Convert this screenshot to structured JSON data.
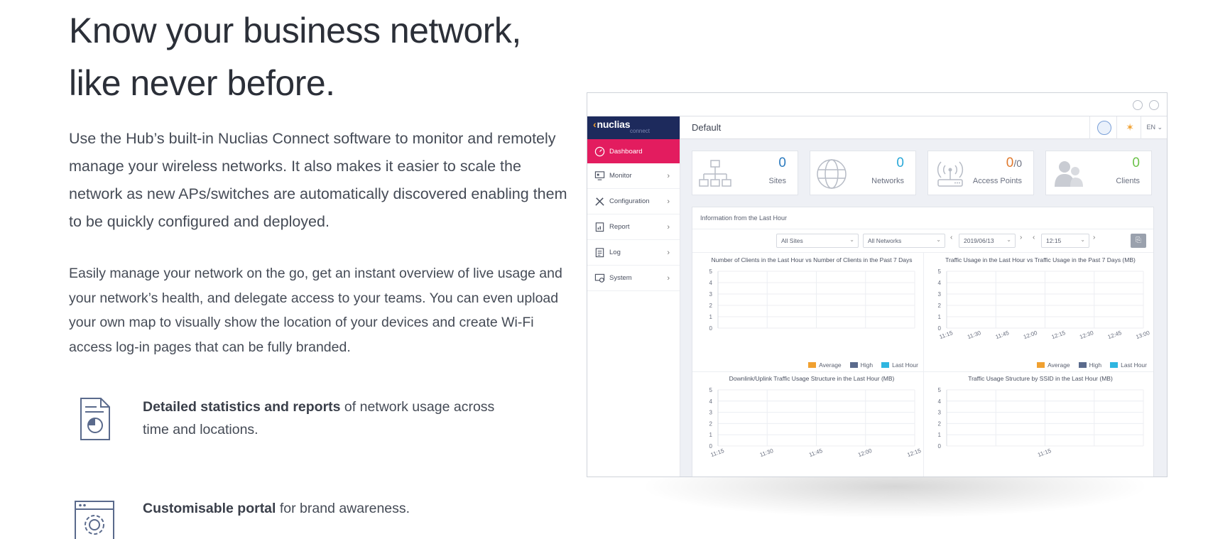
{
  "headline": {
    "line1": "Know your business network,",
    "line2": "like never before."
  },
  "intro": "Use the Hub’s built-in Nuclias Connect software to monitor and remotely manage your wireless networks. It also makes it easier to scale the network as new APs/switches are automatically discovered enabling them to be quickly configured and deployed.",
  "details": "Easily manage your network on the go, get an instant overview of live usage and your network’s health, and delegate access to your teams. You can even upload your own map to visually show the location of your devices and create Wi-Fi access log-in pages that can be fully branded.",
  "features": [
    {
      "icon": "report-document-icon",
      "bold": "Detailed statistics and reports",
      "rest": " of network usage across time and locations."
    },
    {
      "icon": "browser-gear-icon",
      "bold": "Customisable portal",
      "rest": " for brand awareness."
    }
  ],
  "app": {
    "brand": {
      "name": "nuclias",
      "sub": "connect"
    },
    "page_title": "Default",
    "language": "EN",
    "nav": [
      {
        "label": "Dashboard",
        "icon": "dashboard-gauge-icon",
        "active": true,
        "arrow": ""
      },
      {
        "label": "Monitor",
        "icon": "monitor-icon",
        "active": false,
        "arrow": "›"
      },
      {
        "label": "Configuration",
        "icon": "tools-icon",
        "active": false,
        "arrow": "›"
      },
      {
        "label": "Report",
        "icon": "report-icon",
        "active": false,
        "arrow": "›"
      },
      {
        "label": "Log",
        "icon": "log-icon",
        "active": false,
        "arrow": "›"
      },
      {
        "label": "System",
        "icon": "system-icon",
        "active": false,
        "arrow": "›"
      }
    ],
    "stats": [
      {
        "label": "Sites",
        "value": "0",
        "icon": "sites-tree-icon"
      },
      {
        "label": "Networks",
        "value": "0",
        "icon": "globe-icon"
      },
      {
        "label": "Access Points",
        "value": "0",
        "value_suffix": "/0",
        "icon": "access-point-icon"
      },
      {
        "label": "Clients",
        "value": "0",
        "icon": "clients-icon"
      }
    ],
    "panel": {
      "title": "Information from the Last Hour",
      "filters": {
        "site": "All Sites",
        "network": "All Networks",
        "date": "2019/06/13",
        "time": "12:15"
      },
      "pager": {
        "prev": "‹",
        "next": "›"
      }
    },
    "colors": {
      "average": "#f0a030",
      "high": "#5a6a8c",
      "last_hour": "#2fb6e0",
      "accent": "#e31c5f",
      "brand_bg": "#1d2a5c"
    },
    "legend": [
      "Average",
      "High",
      "Last Hour"
    ]
  },
  "chart_data": [
    {
      "type": "line",
      "title": "Number of Clients in the Last Hour vs Number of Clients in the Past 7 Days",
      "xlabel": "",
      "ylabel": "",
      "ylim": [
        0,
        5
      ],
      "y_ticks": [
        "0",
        "1",
        "2",
        "3",
        "4",
        "5"
      ],
      "x": [],
      "series": [
        {
          "name": "Average",
          "values": []
        },
        {
          "name": "High",
          "values": []
        },
        {
          "name": "Last Hour",
          "values": []
        }
      ],
      "grid": true,
      "legend": "bottom-right"
    },
    {
      "type": "line",
      "title": "Traffic Usage in the Last Hour vs Traffic Usage in the Past 7 Days (MB)",
      "xlabel": "",
      "ylabel": "",
      "ylim": [
        0,
        5
      ],
      "y_ticks": [
        "0",
        "1",
        "2",
        "3",
        "4",
        "5"
      ],
      "x": [
        "11:15",
        "11:30",
        "11:45",
        "12:00",
        "12:15",
        "12:30",
        "12:45",
        "13:00"
      ],
      "series": [
        {
          "name": "Average",
          "values": []
        },
        {
          "name": "High",
          "values": []
        },
        {
          "name": "Last Hour",
          "values": []
        }
      ],
      "grid": true,
      "legend": "bottom-right"
    },
    {
      "type": "area",
      "title": "Downlink/Uplink Traffic Usage Structure in the Last Hour (MB)",
      "xlabel": "",
      "ylabel": "",
      "ylim": [
        0,
        5
      ],
      "y_ticks": [
        "0",
        "1",
        "2",
        "3",
        "4",
        "5"
      ],
      "x": [
        "11:15",
        "11:30",
        "11:45",
        "12:00",
        "12:15"
      ],
      "series": [],
      "grid": true
    },
    {
      "type": "area",
      "title": "Traffic Usage Structure by SSID in the Last Hour (MB)",
      "xlabel": "",
      "ylabel": "",
      "ylim": [
        0,
        5
      ],
      "y_ticks": [
        "0",
        "1",
        "2",
        "3",
        "4",
        "5"
      ],
      "x": [
        "11:15"
      ],
      "series": [],
      "grid": true
    }
  ]
}
